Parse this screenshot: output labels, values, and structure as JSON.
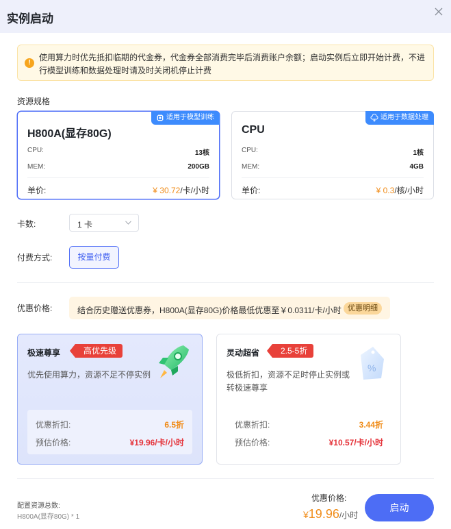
{
  "dialog": {
    "title": "实例启动"
  },
  "notice": {
    "icon": "warning-icon",
    "text": "使用算力时优先抵扣临期的代金券，代金券全部消费完毕后消费账户余额；启动实例后立即开始计费，不进行模型训练和数据处理时请及时关闭机停止计费"
  },
  "resource": {
    "label": "资源规格",
    "cards": [
      {
        "tag": "适用于模型训练",
        "name": "H800A(显存80G)",
        "cpu_key": "CPU:",
        "cpu_val": "13核",
        "mem_key": "MEM:",
        "mem_val": "200GB",
        "price_key": "单价:",
        "price_amt": "¥ 30.72",
        "price_unit": "/卡/小时",
        "selected": true
      },
      {
        "tag": "适用于数据处理",
        "name": "CPU",
        "cpu_key": "CPU:",
        "cpu_val": "1核",
        "mem_key": "MEM:",
        "mem_val": "4GB",
        "price_key": "单价:",
        "price_amt": "¥ 0.3",
        "price_unit": "/核/小时",
        "selected": false
      }
    ]
  },
  "cards_count": {
    "label": "卡数:",
    "value": "1 卡"
  },
  "payment": {
    "label": "付费方式:",
    "option": "按量付费"
  },
  "discount": {
    "label": "优惠价格:",
    "text": "结合历史赠送优惠券，H800A(显存80G)价格最低优惠至￥0.0311/卡/小时",
    "link": "优惠明细"
  },
  "plans": [
    {
      "name": "极速尊享",
      "badge": "高优先级",
      "desc": "优先使用算力，资源不足不停实例",
      "discount_key": "优惠折扣:",
      "discount_val": "6.5折",
      "price_key": "预估价格:",
      "price_val": "¥19.96/卡/小时"
    },
    {
      "name": "灵动超省",
      "badge": "2.5-5折",
      "desc_line1": "极低折扣，资源不足时停止实例或",
      "desc_line2": "转极速尊享",
      "discount_key": "优惠折扣:",
      "discount_val": "3.44折",
      "price_key": "预估价格:",
      "price_val": "¥10.57/卡/小时"
    }
  ],
  "footer": {
    "config_label": "配置资源总数:",
    "config_value": "H800A(显存80G) * 1",
    "price_label": "优惠价格:",
    "price_currency": "¥",
    "price_num": "19.96",
    "price_unit": "/小时",
    "launch_label": "启动"
  },
  "colors": {
    "accent": "#4d6df5",
    "price_orange": "#f08c19",
    "badge_red": "#e8413a",
    "tag_blue": "#3d8bfd"
  }
}
